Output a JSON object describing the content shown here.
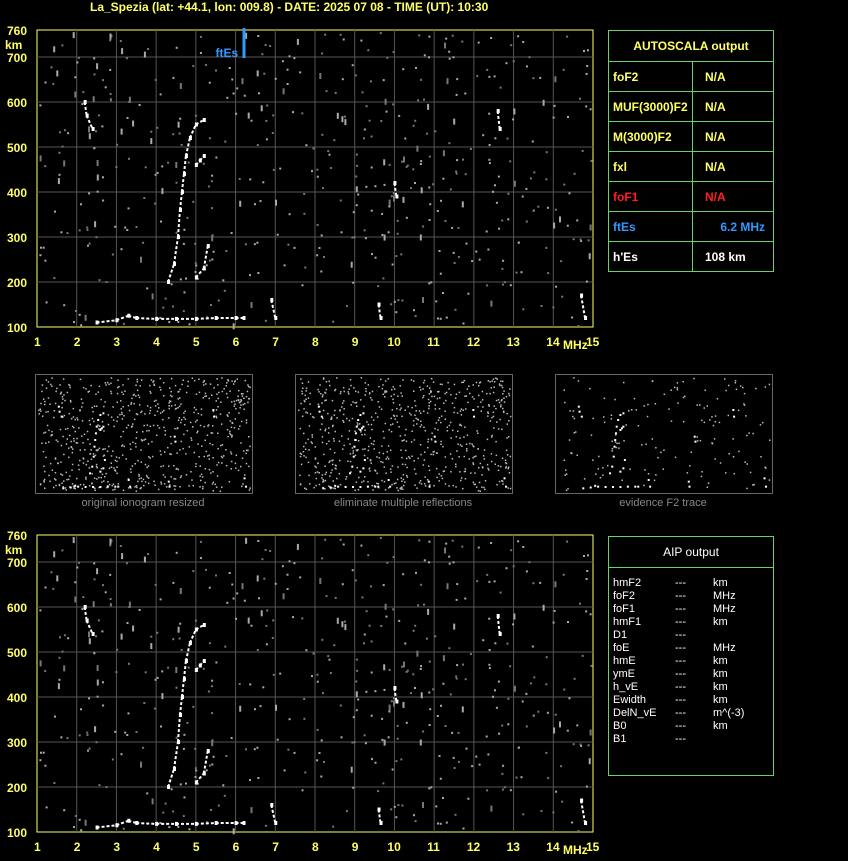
{
  "header": {
    "title": "La_Spezia (lat: +44.1, lon: 009.8) - DATE: 2025 07 08 - TIME (UT): 10:30"
  },
  "chart_data": {
    "type": "scatter",
    "xlabel": "MHz",
    "ylabel": "km",
    "xlim": [
      1,
      15
    ],
    "ylim": [
      100,
      760
    ],
    "x_ticks": [
      "1",
      "2",
      "3",
      "4",
      "5",
      "6",
      "7",
      "8",
      "9",
      "10",
      "11",
      "12",
      "13",
      "14",
      "15"
    ],
    "y_ticks": [
      "100",
      "200",
      "300",
      "400",
      "500",
      "600",
      "700",
      "760"
    ],
    "grid": true,
    "annotation": {
      "text": "ftEs",
      "x": 6.2,
      "color": "#3399ff"
    },
    "traces": [
      {
        "name": "Es",
        "points": [
          [
            2.5,
            110
          ],
          [
            3,
            115
          ],
          [
            3.3,
            125
          ],
          [
            3.5,
            120
          ],
          [
            4,
            118
          ],
          [
            4.5,
            118
          ],
          [
            5,
            118
          ],
          [
            5.5,
            120
          ],
          [
            6,
            120
          ],
          [
            6.2,
            120
          ]
        ]
      },
      {
        "name": "F",
        "points": [
          [
            4.3,
            200
          ],
          [
            4.45,
            240
          ],
          [
            4.55,
            300
          ],
          [
            4.6,
            360
          ],
          [
            4.65,
            400
          ],
          [
            4.7,
            440
          ],
          [
            4.75,
            480
          ],
          [
            4.85,
            520
          ],
          [
            5.0,
            550
          ],
          [
            5.2,
            560
          ]
        ]
      },
      {
        "name": "F-high",
        "points": [
          [
            5.0,
            460
          ],
          [
            5.1,
            470
          ],
          [
            5.2,
            480
          ]
        ]
      },
      {
        "name": "F-low",
        "points": [
          [
            5.0,
            210
          ],
          [
            5.2,
            230
          ],
          [
            5.3,
            280
          ]
        ]
      },
      {
        "name": "mult",
        "points": [
          [
            2.2,
            600
          ],
          [
            2.25,
            570
          ],
          [
            2.4,
            540
          ],
          [
            12.6,
            580
          ],
          [
            12.65,
            540
          ],
          [
            10.0,
            420
          ],
          [
            10.05,
            390
          ],
          [
            9.6,
            150
          ],
          [
            9.65,
            120
          ],
          [
            14.7,
            170
          ],
          [
            14.8,
            120
          ],
          [
            6.9,
            160
          ],
          [
            7.0,
            120
          ]
        ]
      }
    ]
  },
  "autoscala": {
    "title": "AUTOSCALA output",
    "rows": [
      {
        "key": "foF2",
        "value": "N/A",
        "color": "#ffff66",
        "vcolor": "#ffff66"
      },
      {
        "key": "MUF(3000)F2",
        "value": "N/A",
        "color": "#ffff66",
        "vcolor": "#ffff66"
      },
      {
        "key": "M(3000)F2",
        "value": "N/A",
        "color": "#ffff66",
        "vcolor": "#ffff66"
      },
      {
        "key": "fxl",
        "value": "N/A",
        "color": "#ffff66",
        "vcolor": "#ffff66"
      },
      {
        "key": "foF1",
        "value": "N/A",
        "color": "#ff2020",
        "vcolor": "#ff2020"
      },
      {
        "key": "ftEs",
        "value": "6.2 MHz",
        "color": "#3399ff",
        "vcolor": "#3399ff"
      },
      {
        "key": "h'Es",
        "value": "108      km",
        "color": "#ffffff",
        "vcolor": "#ffffff"
      }
    ]
  },
  "thumbnails": [
    {
      "caption": "original ionogram resized"
    },
    {
      "caption": "eliminate multiple reflections"
    },
    {
      "caption": "evidence F2 trace"
    }
  ],
  "aip": {
    "title": "AIP output",
    "rows": [
      {
        "p": "hmF2",
        "v": "---",
        "u": "km"
      },
      {
        "p": "foF2",
        "v": "---",
        "u": "MHz"
      },
      {
        "p": "foF1",
        "v": "---",
        "u": "MHz"
      },
      {
        "p": "hmF1",
        "v": "---",
        "u": "km"
      },
      {
        "p": "D1",
        "v": "---",
        "u": ""
      },
      {
        "p": "foE",
        "v": "---",
        "u": "MHz"
      },
      {
        "p": "hmE",
        "v": "---",
        "u": "km"
      },
      {
        "p": "ymE",
        "v": "---",
        "u": "km"
      },
      {
        "p": "h_vE",
        "v": "---",
        "u": "km"
      },
      {
        "p": "Ewidth",
        "v": "---",
        "u": "km"
      },
      {
        "p": "DelN_vE",
        "v": "---",
        "u": "m^(-3)"
      },
      {
        "p": "B0",
        "v": "---",
        "u": "km"
      },
      {
        "p": "B1",
        "v": "---",
        "u": ""
      }
    ]
  }
}
